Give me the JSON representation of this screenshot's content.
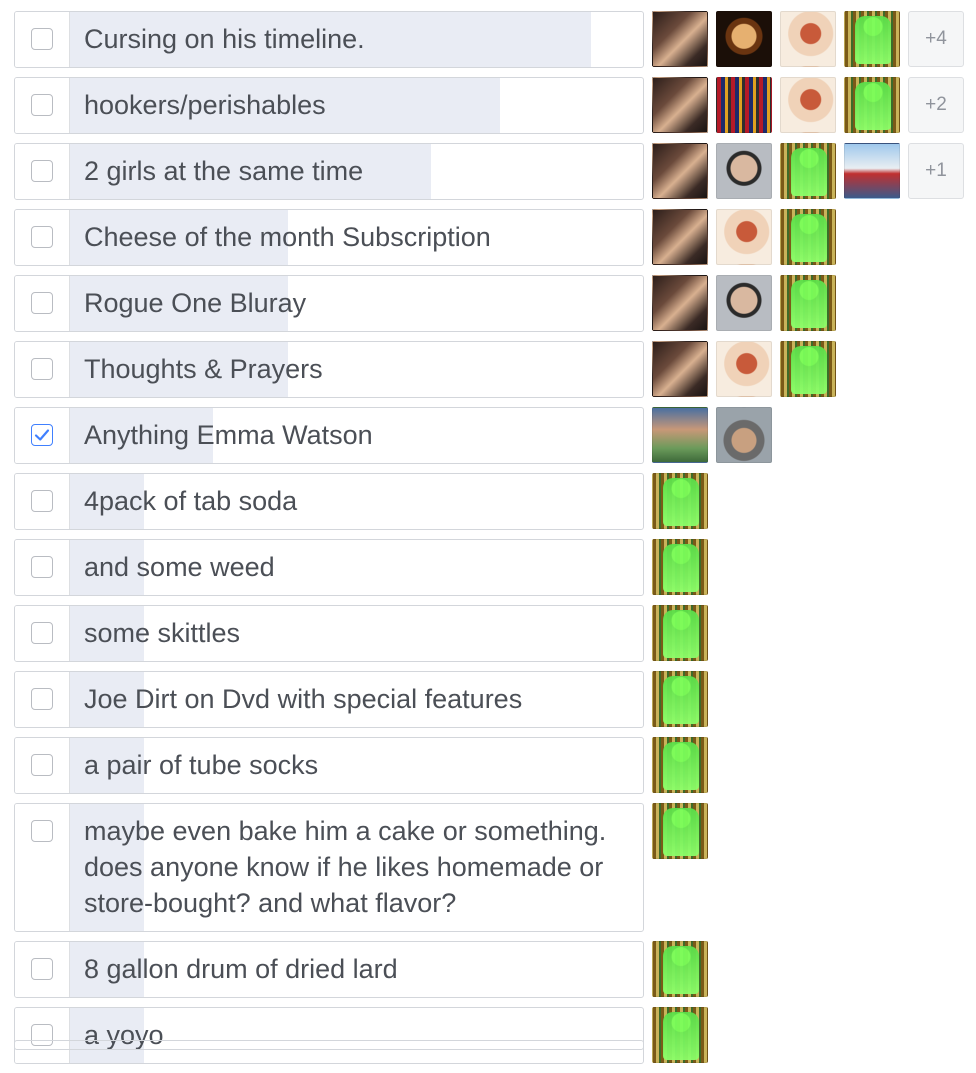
{
  "poll": {
    "options": [
      {
        "label": "Cursing on his timeline.",
        "checked": false,
        "vote_fraction": 0.91,
        "voters": [
          "avatar-couple",
          "avatar-alien",
          "avatar-pinup",
          "avatar-frank"
        ],
        "more": "+4"
      },
      {
        "label": "hookers/perishables",
        "checked": false,
        "vote_fraction": 0.75,
        "voters": [
          "avatar-couple",
          "avatar-pattern",
          "avatar-pinup",
          "avatar-frank"
        ],
        "more": "+2"
      },
      {
        "label": "2 girls at the same time",
        "checked": false,
        "vote_fraction": 0.63,
        "voters": [
          "avatar-couple",
          "avatar-man",
          "avatar-frank",
          "avatar-cyclist"
        ],
        "more": "+1"
      },
      {
        "label": "Cheese of the month Subscription",
        "checked": false,
        "vote_fraction": 0.38,
        "voters": [
          "avatar-couple",
          "avatar-pinup",
          "avatar-frank"
        ]
      },
      {
        "label": "Rogue One Bluray",
        "checked": false,
        "vote_fraction": 0.38,
        "voters": [
          "avatar-couple",
          "avatar-man",
          "avatar-frank"
        ]
      },
      {
        "label": "Thoughts & Prayers",
        "checked": false,
        "vote_fraction": 0.38,
        "voters": [
          "avatar-couple",
          "avatar-pinup",
          "avatar-frank"
        ]
      },
      {
        "label": "Anything Emma Watson",
        "checked": true,
        "vote_fraction": 0.25,
        "voters": [
          "avatar-family",
          "avatar-car"
        ]
      },
      {
        "label": "4pack of tab soda",
        "checked": false,
        "vote_fraction": 0.13,
        "voters": [
          "avatar-frank"
        ]
      },
      {
        "label": "and some weed",
        "checked": false,
        "vote_fraction": 0.13,
        "voters": [
          "avatar-frank"
        ]
      },
      {
        "label": "some skittles",
        "checked": false,
        "vote_fraction": 0.13,
        "voters": [
          "avatar-frank"
        ]
      },
      {
        "label": "Joe Dirt on Dvd with special features",
        "checked": false,
        "vote_fraction": 0.13,
        "voters": [
          "avatar-frank"
        ]
      },
      {
        "label": "a pair of tube socks",
        "checked": false,
        "vote_fraction": 0.13,
        "voters": [
          "avatar-frank"
        ]
      },
      {
        "label": "maybe even bake him a cake or something. does anyone know if he likes homemade or store-bought? and what flavor?",
        "checked": false,
        "vote_fraction": 0.13,
        "voters": [
          "avatar-frank"
        ]
      },
      {
        "label": "8 gallon drum of dried lard",
        "checked": false,
        "vote_fraction": 0.13,
        "voters": [
          "avatar-frank"
        ]
      },
      {
        "label": "a yoyo",
        "checked": false,
        "vote_fraction": 0.13,
        "voters": [
          "avatar-frank"
        ]
      }
    ]
  },
  "colors": {
    "result_bar": "#e9ecf4",
    "checkbox_checked": "#4080ff",
    "label_text": "#4b4f56",
    "border": "#d3d6db"
  },
  "icons": {
    "checkmark": "checkmark-icon"
  }
}
